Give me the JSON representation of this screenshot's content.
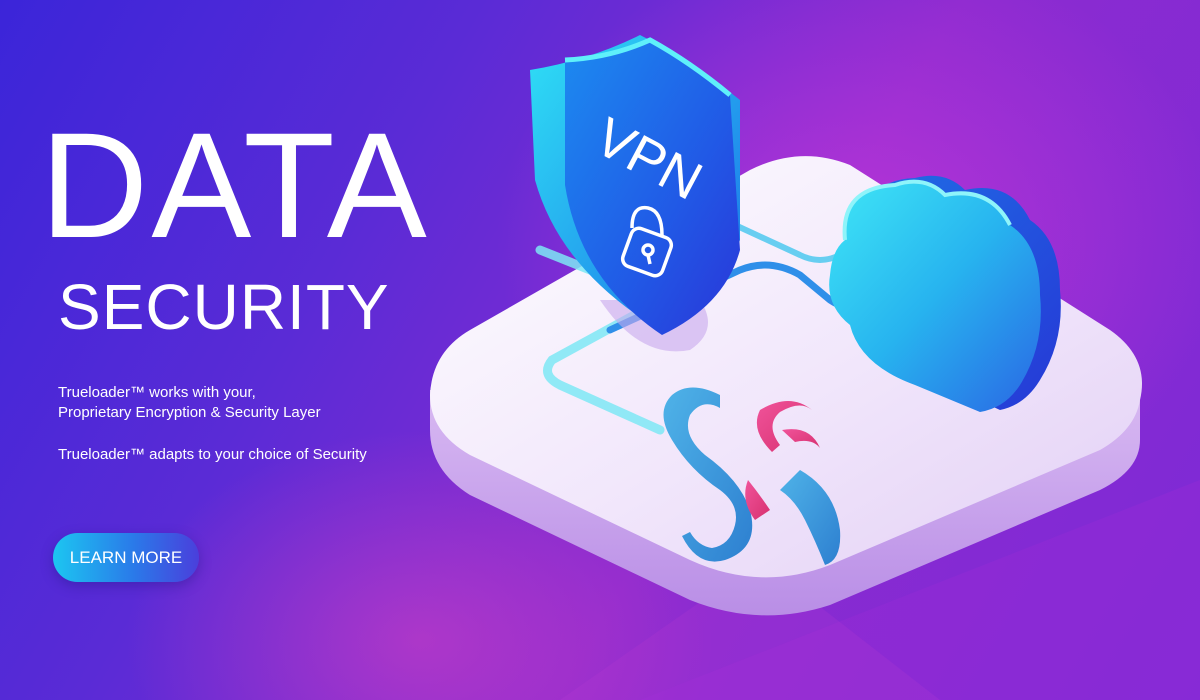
{
  "banner": {
    "headline": "DATA",
    "subheadline": "SECURITY",
    "paragraph_1": {
      "line_1": "Trueloader™ works with your,",
      "line_2": "Proprietary Encryption & Security Layer"
    },
    "paragraph_2": "Trueloader™ adapts to your choice of Security",
    "cta_label": "LEARN MORE"
  },
  "illustration": {
    "shield_text": "VPN",
    "icons": [
      "shield-icon",
      "padlock-icon",
      "cloud-icon",
      "logo-icon"
    ]
  },
  "colors": {
    "background_start": "#3b25d9",
    "background_end": "#8c2bd0",
    "accent_cyan": "#1cc6f1",
    "accent_blue": "#2a7ae9",
    "logo_pink": "#e8468c",
    "logo_blue": "#3a8fd6",
    "text": "#ffffff"
  }
}
